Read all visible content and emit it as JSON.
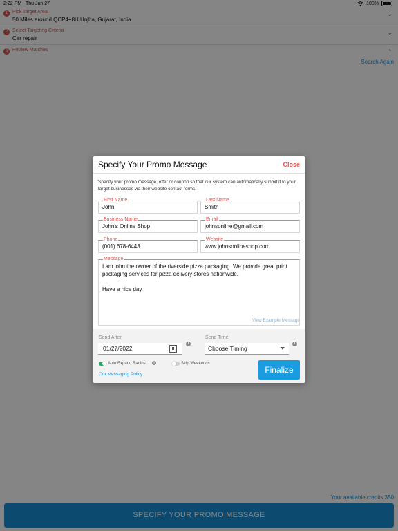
{
  "status_bar": {
    "time": "2:22 PM",
    "date": "Thu Jan 27",
    "battery": "100%"
  },
  "background": {
    "steps": [
      {
        "number": "1",
        "label": "Pick Target Area",
        "value": "50 Miles around QCP4+8H Unjha, Gujarat, India"
      },
      {
        "number": "2",
        "label": "Select Targeting Criteria",
        "value": "Car repair"
      },
      {
        "number": "3",
        "label": "Review Matches",
        "value": ""
      }
    ],
    "search_again": "Search Again",
    "credits": "Your available credits 350",
    "bottom_button": "SPECIFY YOUR PROMO MESSAGE"
  },
  "modal": {
    "title": "Specify Your Promo Message",
    "close": "Close",
    "intro": "Specify your promo message, offer or coupon so that our system can automatically submit it to your target businesses via their website contact forms.",
    "fields": {
      "first_name": {
        "label": "First Name",
        "value": "John"
      },
      "last_name": {
        "label": "Last Name",
        "value": "Smith"
      },
      "business_name": {
        "label": "Business Name",
        "value": "John's Online Shop"
      },
      "email": {
        "label": "Email",
        "value": "johnsonline@gmail.com"
      },
      "phone": {
        "label": "Phone",
        "value": "(001) 678-6443"
      },
      "website": {
        "label": "Website",
        "value": "www.johnsonlineshop.com"
      },
      "message": {
        "label": "Message",
        "line1": "I am john the owner of the riverside pizza packaging. We provide great print packaging services for pizza delivery stores nationwide.",
        "line2": "Have a nice day."
      }
    },
    "example_link": "View Example Message",
    "send_after": {
      "label": "Send After",
      "value": "01/27/2022"
    },
    "send_time": {
      "label": "Send Time",
      "value": "Choose Timing"
    },
    "auto_expand": {
      "label": "Auto Expand Radius",
      "on": true
    },
    "skip_weekends": {
      "label": "Skip Weekends",
      "on": false
    },
    "policy_link": "Our Messaging Policy",
    "finalize": "Finalize",
    "colors": {
      "accent": "#1a8fd6",
      "danger": "#e0534f",
      "toggle_on": "#2aa86a"
    }
  }
}
